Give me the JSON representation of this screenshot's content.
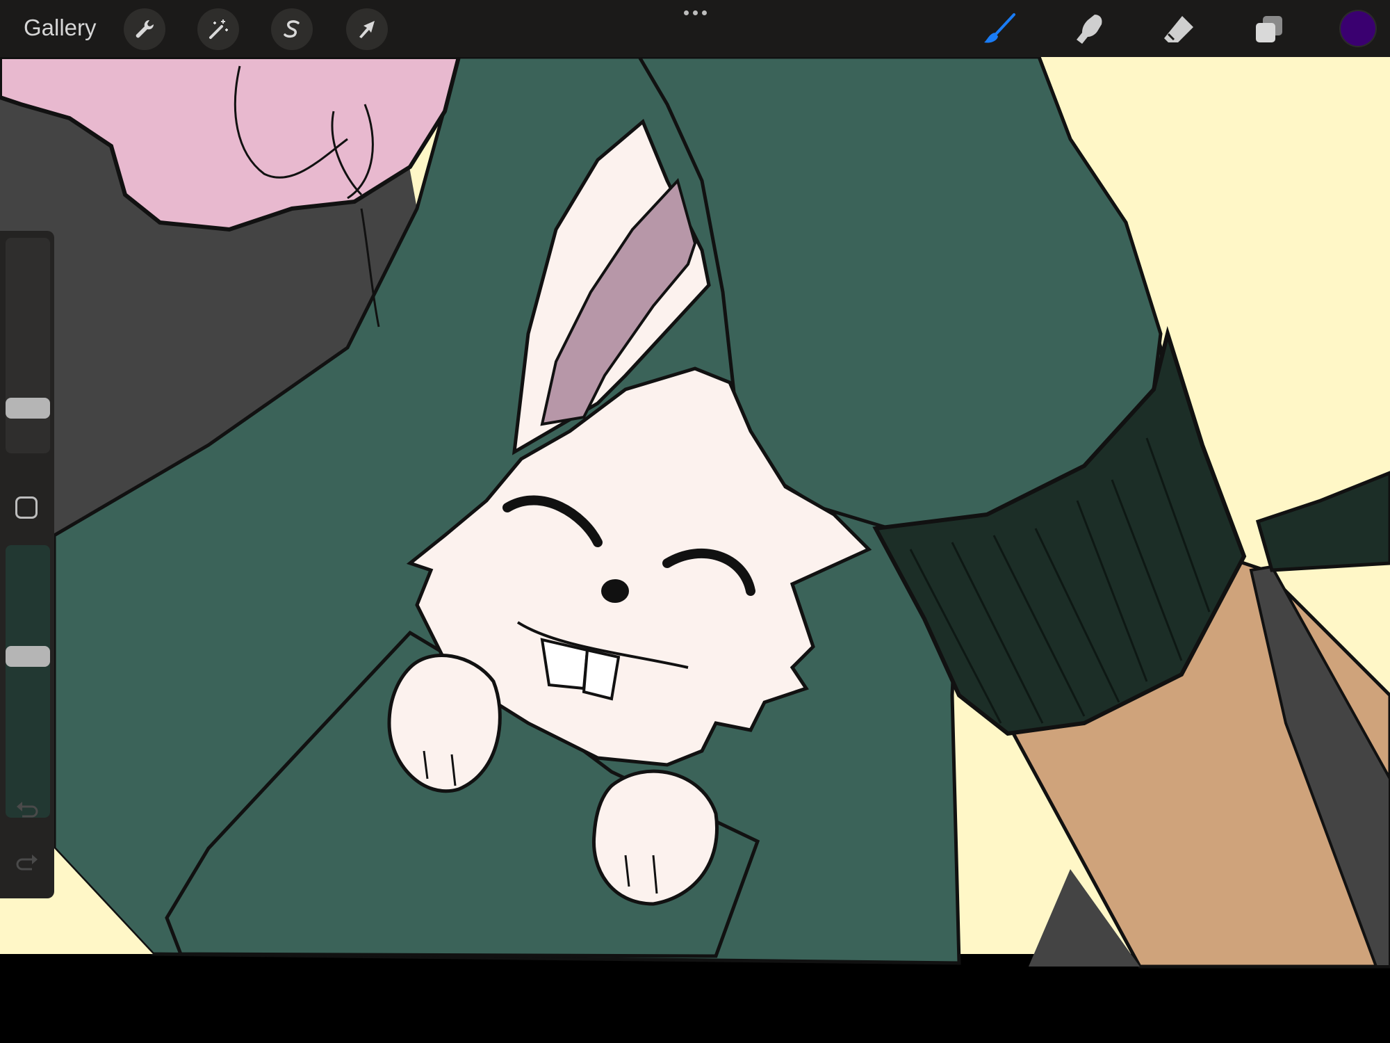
{
  "app": {
    "gallery_label": "Gallery"
  },
  "toolbar_left": {
    "tools": [
      {
        "name": "actions",
        "icon": "wrench-icon"
      },
      {
        "name": "adjustments",
        "icon": "magic-wand-icon"
      },
      {
        "name": "selection",
        "icon": "selection-s-icon"
      },
      {
        "name": "transform",
        "icon": "arrow-cursor-icon"
      }
    ]
  },
  "toolbar_center": {
    "icon": "more-dots-icon"
  },
  "toolbar_right": {
    "tools": [
      {
        "name": "brush",
        "icon": "brush-icon",
        "active": true
      },
      {
        "name": "smudge",
        "icon": "smudge-finger-icon",
        "active": false
      },
      {
        "name": "eraser",
        "icon": "eraser-icon",
        "active": false
      },
      {
        "name": "layers",
        "icon": "layers-icon",
        "active": false
      }
    ],
    "current_color": "#3a0070"
  },
  "sidebar": {
    "brush_size_level": 0.18,
    "opacity_level": 0.6,
    "modify_icon": "square-icon",
    "undo_icon": "undo-icon",
    "redo_icon": "redo-icon"
  },
  "colors": {
    "accent_active": "#1a7cf5",
    "sweater_green": "#3b6359",
    "cuff_green": "#1c2e27",
    "background_cream": "#fff7c7",
    "hair_pink": "#e8b9cf",
    "skin_tan": "#cfa37b",
    "bunny_white": "#fcf2ee",
    "ear_inner": "#b797a8"
  }
}
